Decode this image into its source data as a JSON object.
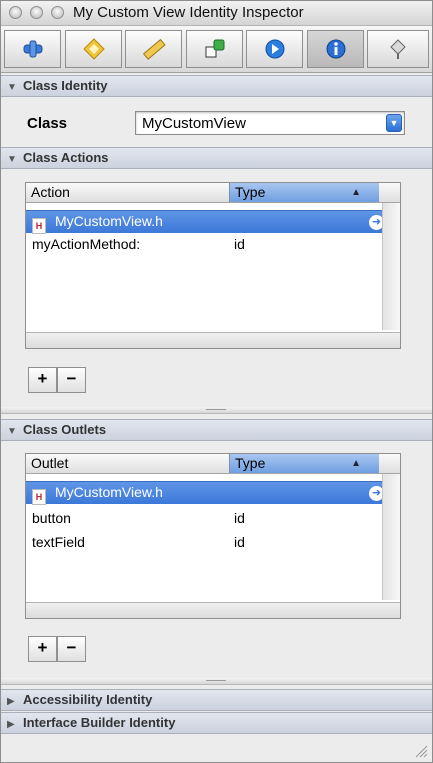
{
  "window": {
    "title": "My Custom View Identity Inspector"
  },
  "toolbar": {
    "tabs": [
      {
        "icon": "attributes-icon"
      },
      {
        "icon": "effects-icon"
      },
      {
        "icon": "size-ruler-icon"
      },
      {
        "icon": "connections-icon"
      },
      {
        "icon": "bindings-arrow-icon"
      },
      {
        "icon": "identity-info-icon"
      },
      {
        "icon": "applescript-icon"
      }
    ],
    "selected_index": 5
  },
  "class_identity": {
    "header": "Class Identity",
    "class_label": "Class",
    "class_value": "MyCustomView"
  },
  "class_actions": {
    "header": "Class Actions",
    "col_action": "Action",
    "col_type": "Type",
    "rows": [
      {
        "name": "MyCustomView.h",
        "type": "",
        "selected": true
      },
      {
        "name": "myActionMethod:",
        "type": "id"
      }
    ],
    "add_label": "+",
    "remove_label": "−"
  },
  "class_outlets": {
    "header": "Class Outlets",
    "col_outlet": "Outlet",
    "col_type": "Type",
    "rows": [
      {
        "name": "MyCustomView.h",
        "type": "",
        "selected": true
      },
      {
        "name": "button",
        "type": "id"
      },
      {
        "name": "textField",
        "type": "id"
      }
    ],
    "add_label": "+",
    "remove_label": "−"
  },
  "accessibility": {
    "header": "Accessibility Identity"
  },
  "ib_identity": {
    "header": "Interface Builder Identity"
  },
  "colors": {
    "selection": "#3c78d8",
    "section_header": "#cbd2de"
  }
}
